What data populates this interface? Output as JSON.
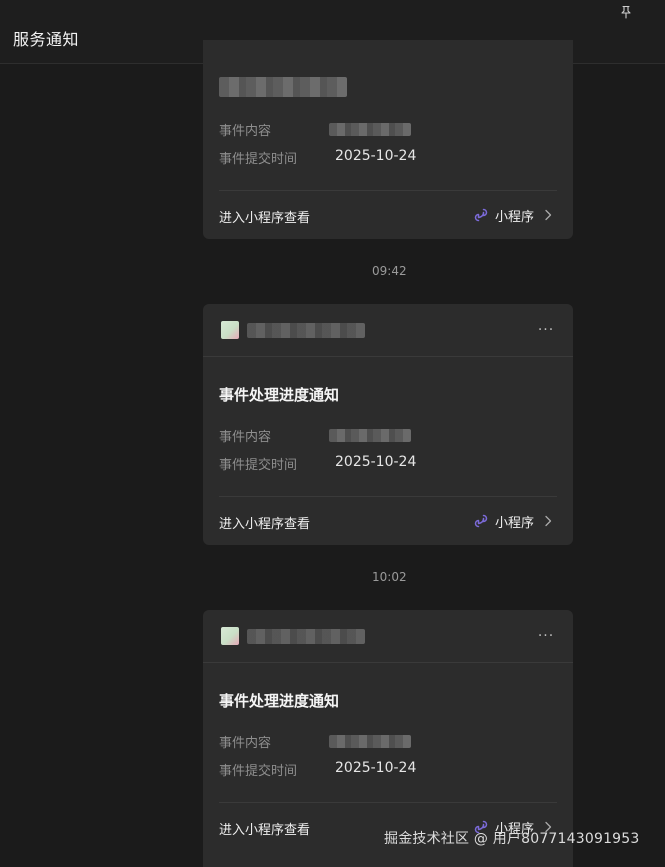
{
  "header": {
    "title": "服务通知"
  },
  "icons": {
    "pin": "pin-icon",
    "more": "more-icon",
    "mini_program": "mini-program-link-icon",
    "chevron": "chevron-right-icon"
  },
  "colors": {
    "background": "#1b1b1b",
    "card": "#2c2c2c",
    "mini_program_icon": "#7b6ad8"
  },
  "cards": [
    {
      "title": "",
      "content_label": "事件内容",
      "time_label": "事件提交时间",
      "time_value": "2025-10-24",
      "footer_link": "进入小程序查看",
      "mini_program": "小程序"
    },
    {
      "title": "事件处理进度通知",
      "content_label": "事件内容",
      "time_label": "事件提交时间",
      "time_value": "2025-10-24",
      "footer_link": "进入小程序查看",
      "mini_program": "小程序",
      "more": "···"
    },
    {
      "title": "事件处理进度通知",
      "content_label": "事件内容",
      "time_label": "事件提交时间",
      "time_value": "2025-10-24",
      "footer_link": "进入小程序查看",
      "mini_program": "小程序",
      "more": "···"
    }
  ],
  "timestamps": [
    "09:42",
    "10:02"
  ],
  "watermark": "掘金技术社区 @ 用户8077143091953"
}
